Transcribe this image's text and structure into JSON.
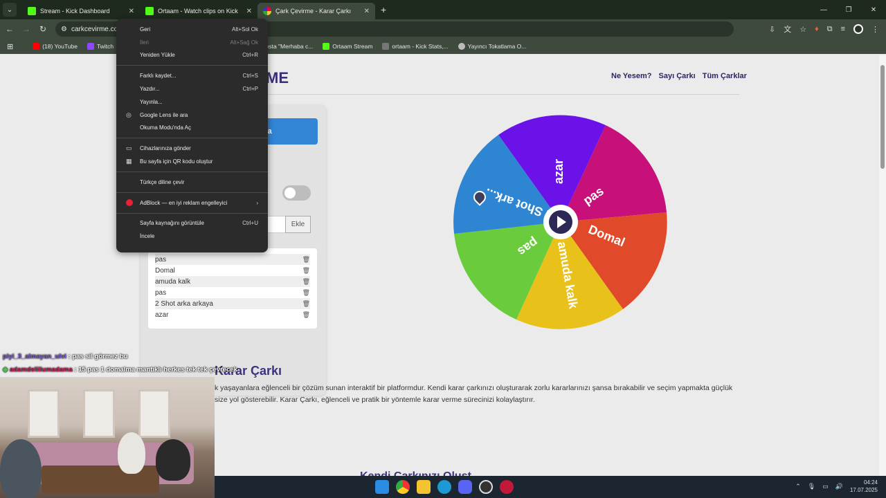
{
  "browser": {
    "tabs": [
      {
        "label": "Stream - Kick Dashboard",
        "icon": "kick-icon",
        "active": false
      },
      {
        "label": "Ortaam - Watch clips on Kick",
        "icon": "kick-icon",
        "active": false
      },
      {
        "label": "Çark Çevirme - Karar Çarkı",
        "icon": "wheel-icon",
        "active": true
      }
    ],
    "url": "carkcevirme.com",
    "bookmarks": [
      {
        "label": "(18) YouTube",
        "color": "#ff0000"
      },
      {
        "label": "Twitch",
        "color": "#9146ff"
      },
      {
        "label": "-posta \"Merhaba c...",
        "color": "#888888"
      },
      {
        "label": "Ortaam Stream",
        "color": "#53fc18"
      },
      {
        "label": "ortaam - Kick Stats,...",
        "color": "#777777"
      },
      {
        "label": "Yayıncı Tokatlama O...",
        "color": "#bbbbbb"
      }
    ]
  },
  "site": {
    "brand_visible": "ME",
    "nav": [
      "Ne Yesem?",
      "Sayı Çarkı",
      "Tüm Çarklar"
    ],
    "spin_button_visible": "rkaya",
    "add_button": "Ekle",
    "entries": [
      "pas",
      "Domal",
      "amuda kalk",
      "pas",
      "2 Shot arka arkaya",
      "azar"
    ],
    "wheel_labels": {
      "azar": "azar",
      "pas1": "pas",
      "domal": "Domal",
      "amuda": "amuda kalk",
      "pas2": "pas",
      "shot": "2 Shot ark..."
    },
    "section_title_visible": "Karar Çarkı",
    "paragraph_line1": "k yaşayanlara eğlenceli bir çözüm sunan interaktif bir platformdur. Kendi karar çarkınızı oluşturarak zorlu kararlarınızı şansa bırakabilir ve seçim yapmakta güçlük",
    "paragraph_line2": "size yol gösterebilir. Karar Çarkı, eğlenceli ve pratik bir yöntemle karar verme sürecinizi kolaylaştırır.",
    "section2_visible": "Kendi Çarkınızı Oluşt"
  },
  "context_menu": {
    "groups": [
      [
        {
          "label": "Geri",
          "shortcut": "Alt+Sol Ok",
          "disabled": false
        },
        {
          "label": "İleri",
          "shortcut": "Alt+Sağ Ok",
          "disabled": true
        },
        {
          "label": "Yeniden Yükle",
          "shortcut": "Ctrl+R",
          "disabled": false
        }
      ],
      [
        {
          "label": "Farklı kaydet...",
          "shortcut": "Ctrl+S",
          "disabled": false
        },
        {
          "label": "Yazdır...",
          "shortcut": "Ctrl+P",
          "disabled": false
        },
        {
          "label": "Yayınla...",
          "shortcut": "",
          "disabled": false
        },
        {
          "label": "Google Lens ile ara",
          "shortcut": "",
          "disabled": false,
          "icon": "lens-icon"
        },
        {
          "label": "Okuma Modu'nda Aç",
          "shortcut": "",
          "disabled": false
        }
      ],
      [
        {
          "label": "Cihazlarınıza gönder",
          "shortcut": "",
          "disabled": false,
          "icon": "devices-icon"
        },
        {
          "label": "Bu sayfa için QR kodu oluştur",
          "shortcut": "",
          "disabled": false,
          "icon": "qr-icon"
        }
      ],
      [
        {
          "label": "Türkçe diline çevir",
          "shortcut": "",
          "disabled": false
        }
      ],
      [
        {
          "label": "AdBlock — en iyi reklam engelleyici",
          "shortcut": "›",
          "disabled": false,
          "icon": "adblock-icon"
        }
      ],
      [
        {
          "label": "Sayfa kaynağını görüntüle",
          "shortcut": "Ctrl+U",
          "disabled": false
        },
        {
          "label": "İncele",
          "shortcut": "",
          "disabled": false
        }
      ]
    ]
  },
  "overlay": {
    "chat": [
      {
        "user": "piyi_3_almayan_ulvi",
        "message": ": pas sil görmez bu"
      },
      {
        "user": "adamdeliilumadama",
        "message": ": 15 pas 1 domalma mantıklı herkes tek tek çevrecek"
      }
    ]
  },
  "system": {
    "time": "04:24",
    "date": "17.07.2025"
  },
  "colors": {
    "accent": "#3386d6",
    "brand": "#3a2e7a",
    "wheel": [
      "#6a12e8",
      "#c8107a",
      "#e04a2a",
      "#e8c21a",
      "#6acb3c",
      "#2e86d2"
    ]
  }
}
